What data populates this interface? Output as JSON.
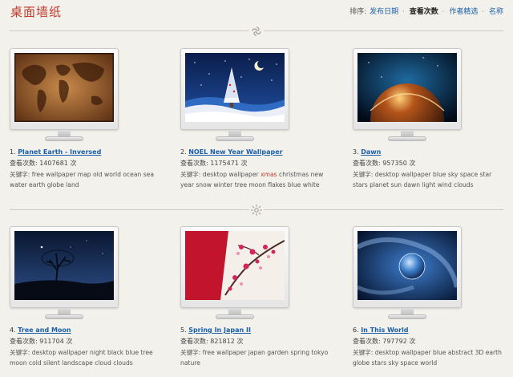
{
  "page": {
    "title": "桌面墙纸"
  },
  "sort": {
    "label": "排序:",
    "options": [
      "发布日期",
      "查看次数",
      "作者精选",
      "名称"
    ],
    "active_index": 1,
    "separator": "·"
  },
  "items": [
    {
      "index": "1.",
      "name": "Planet Earth - Inversed",
      "views_label": "查看次数:",
      "views": "1407681",
      "views_unit": "次",
      "tags_label": "关键字:",
      "tags_pre": "free wallpaper map old world ocean sea water earth globe land",
      "tags_hl": "",
      "tags_post": ""
    },
    {
      "index": "2.",
      "name": "NOEL New Year Wallpaper",
      "views_label": "查看次数:",
      "views": "1175471",
      "views_unit": "次",
      "tags_label": "关键字:",
      "tags_pre": "desktop wallpaper",
      "tags_hl": "xmas",
      "tags_post": "christmas new year snow winter tree moon flakes blue white"
    },
    {
      "index": "3.",
      "name": "Dawn",
      "views_label": "查看次数:",
      "views": "957350",
      "views_unit": "次",
      "tags_label": "关键字:",
      "tags_pre": "desktop wallpaper blue sky space star stars planet sun dawn light wind clouds",
      "tags_hl": "",
      "tags_post": ""
    },
    {
      "index": "4.",
      "name": "Tree and Moon",
      "views_label": "查看次数:",
      "views": "911704",
      "views_unit": "次",
      "tags_label": "关键字:",
      "tags_pre": "desktop wallpaper night black blue tree moon cold silent landscape cloud clouds",
      "tags_hl": "",
      "tags_post": ""
    },
    {
      "index": "5.",
      "name": "Spring In Japan II",
      "views_label": "查看次数:",
      "views": "821812",
      "views_unit": "次",
      "tags_label": "关键字:",
      "tags_pre": "free wallpaper japan garden spring tokyo nature",
      "tags_hl": "",
      "tags_post": ""
    },
    {
      "index": "6.",
      "name": "In This World",
      "views_label": "查看次数:",
      "views": "797792",
      "views_unit": "次",
      "tags_label": "关键字:",
      "tags_pre": "desktop wallpaper blue abstract 3D earth globe stars sky space world",
      "tags_hl": "",
      "tags_post": ""
    }
  ],
  "colors": {
    "link": "#1a5fa8",
    "title": "#c0392b",
    "highlight": "#c0392b",
    "background": "#f3f1ec"
  }
}
